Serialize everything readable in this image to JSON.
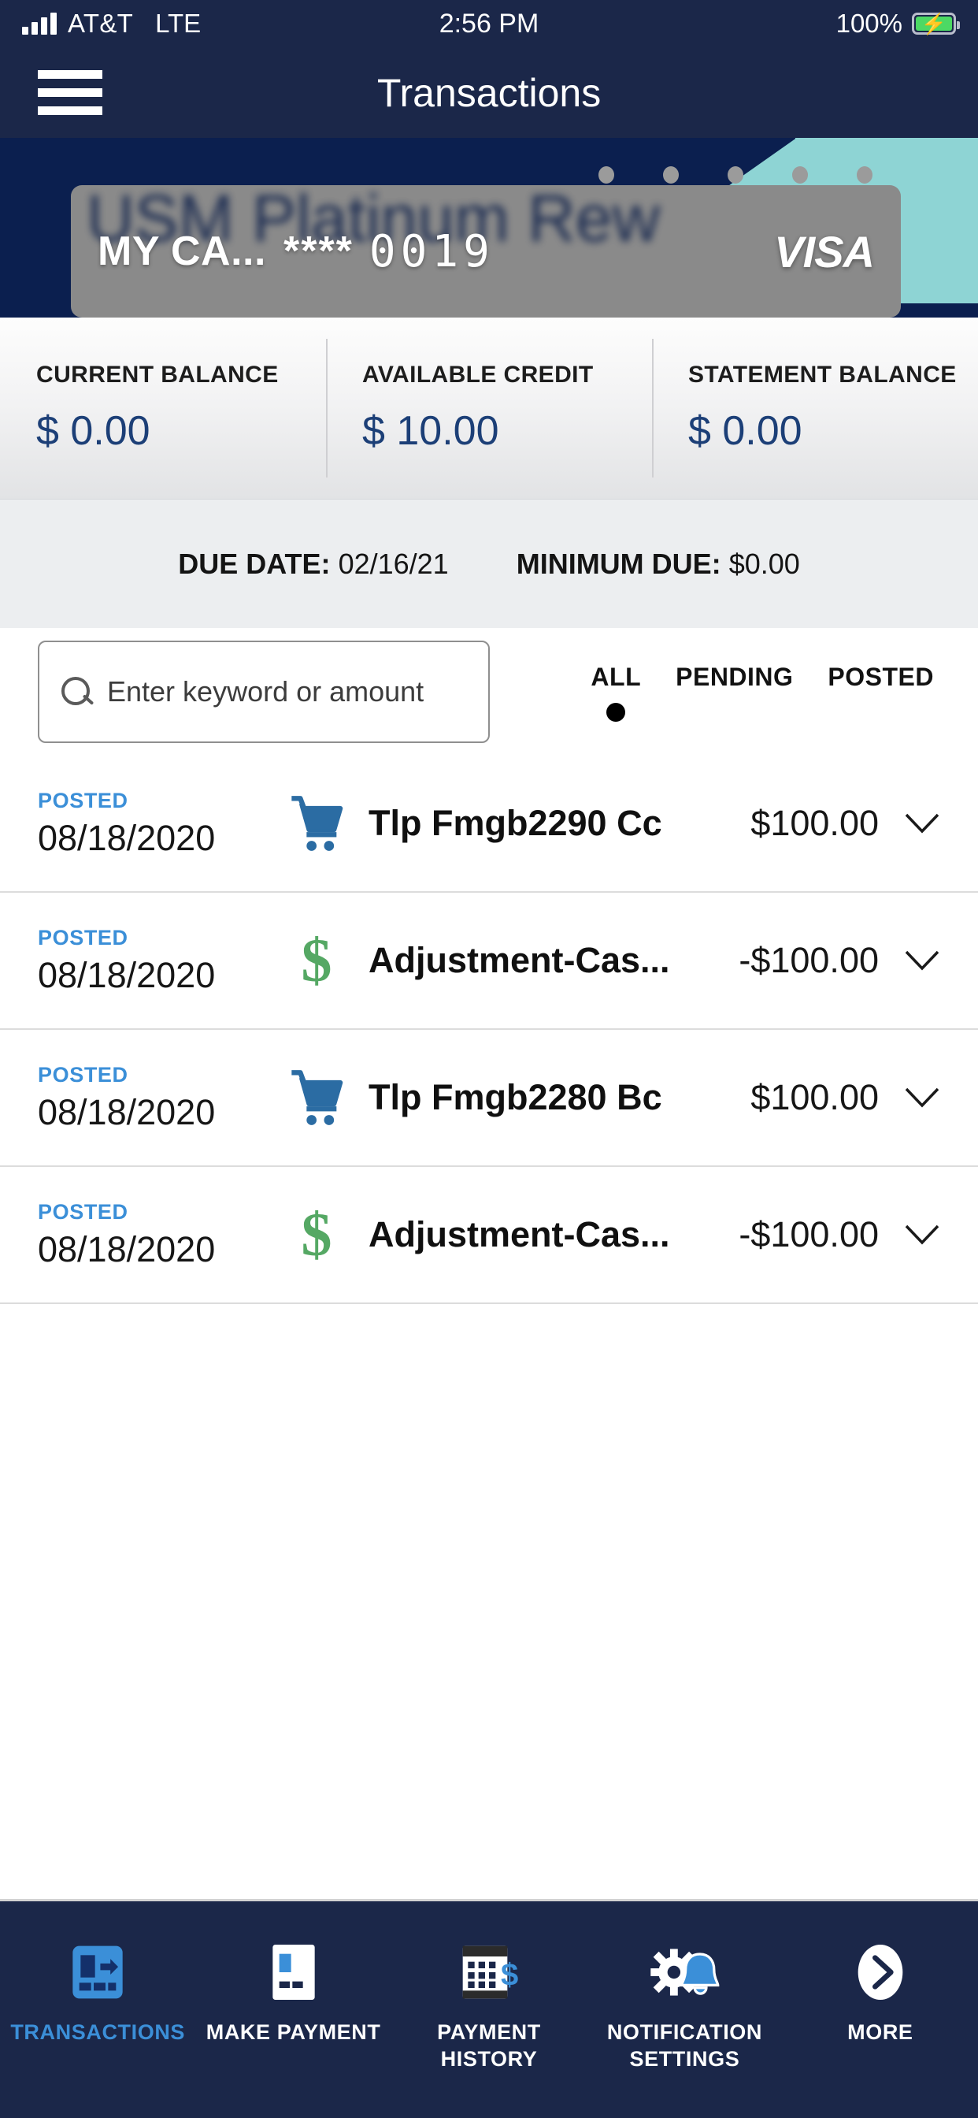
{
  "status_bar": {
    "carrier": "AT&T",
    "network": "LTE",
    "time": "2:56 PM",
    "battery_percent": "100%",
    "signal_icon": "signal-bars-icon",
    "battery_icon": "battery-charging-icon"
  },
  "header": {
    "title": "Transactions",
    "menu_icon": "hamburger-menu-icon"
  },
  "card_carousel": {
    "dot_count": 5,
    "active_index": 0,
    "ghost_card_label": "USM Platinum Rew",
    "card": {
      "nickname": "MY CA...",
      "mask": "****",
      "last_four": "0019",
      "network_logo": "VISA"
    },
    "colors": {
      "band_navy": "#0b1f4f",
      "accent_teal": "#8ed4d4",
      "card_overlay_gray": "#8a8a8a"
    }
  },
  "balances": [
    {
      "label": "CURRENT BALANCE",
      "value": "$ 0.00"
    },
    {
      "label": "AVAILABLE CREDIT",
      "value": "$ 10.00"
    },
    {
      "label": "STATEMENT BALANCE",
      "value": "$ 0.00"
    }
  ],
  "due_row": {
    "due_date_label": "DUE DATE:",
    "due_date_value": "02/16/21",
    "minimum_due_label": "MINIMUM DUE:",
    "minimum_due_value": "$0.00"
  },
  "search": {
    "placeholder": "Enter keyword or amount",
    "value": "",
    "icon": "search-icon"
  },
  "filter_tabs": [
    {
      "label": "ALL",
      "selected": true
    },
    {
      "label": "PENDING",
      "selected": false
    },
    {
      "label": "POSTED",
      "selected": false
    }
  ],
  "transactions": [
    {
      "status": "POSTED",
      "date": "08/18/2020",
      "icon": "shopping-cart-icon",
      "description": "Tlp Fmgb2290 Cc",
      "amount": "$100.00",
      "expand_icon": "chevron-down-icon"
    },
    {
      "status": "POSTED",
      "date": "08/18/2020",
      "icon": "dollar-sign-icon",
      "description": "Adjustment-Cas...",
      "amount": "-$100.00",
      "expand_icon": "chevron-down-icon"
    },
    {
      "status": "POSTED",
      "date": "08/18/2020",
      "icon": "shopping-cart-icon",
      "description": "Tlp Fmgb2280 Bc",
      "amount": "$100.00",
      "expand_icon": "chevron-down-icon"
    },
    {
      "status": "POSTED",
      "date": "08/18/2020",
      "icon": "dollar-sign-icon",
      "description": "Adjustment-Cas...",
      "amount": "-$100.00",
      "expand_icon": "chevron-down-icon"
    }
  ],
  "bottom_nav": [
    {
      "label": "TRANSACTIONS",
      "icon": "transactions-icon",
      "active": true
    },
    {
      "label": "MAKE PAYMENT",
      "icon": "make-payment-card-icon",
      "active": false
    },
    {
      "label": "PAYMENT\nHISTORY",
      "icon": "payment-history-calendar-icon",
      "active": false
    },
    {
      "label": "NOTIFICATION\nSETTINGS",
      "icon": "gear-bell-icon",
      "active": false
    },
    {
      "label": "MORE",
      "icon": "chevron-right-circle-icon",
      "active": false
    }
  ],
  "theme": {
    "navy": "#1b2749",
    "deep_navy": "#0b1f4f",
    "accent_blue": "#3b8fd8",
    "value_blue": "#1c3f77",
    "green": "#55a864",
    "teal": "#8ed4d4"
  }
}
